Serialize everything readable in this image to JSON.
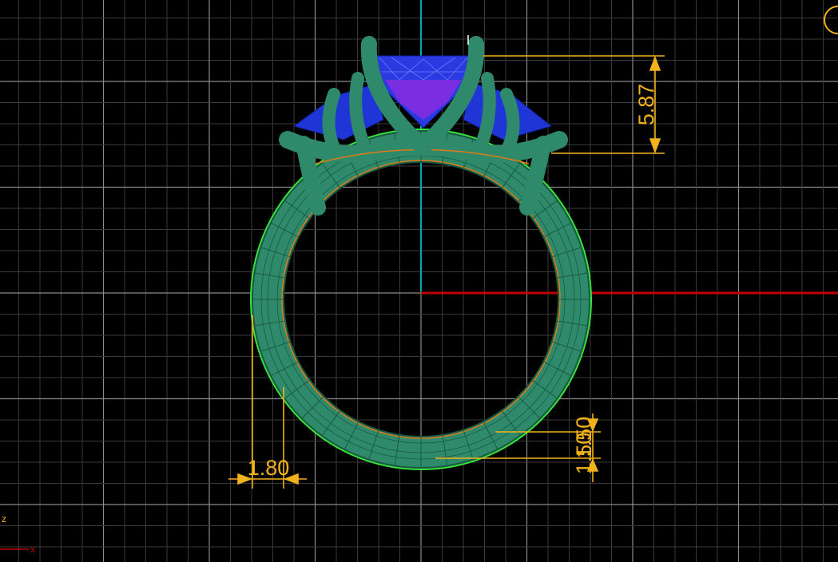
{
  "viewport": {
    "colors": {
      "background": "#000000",
      "grid_minor": "#3a3a3a",
      "grid_major": "#8a8a8a",
      "axis_x": "#c00000",
      "axis_y": "#00a8b0",
      "model": "#2e8a6a",
      "model_edge": "#1a5a44",
      "selection": "#39e639",
      "stone": "#2035d6",
      "center_stone": "#8a2be2",
      "dimension": "#f2b21a",
      "curve": "#e07a1a"
    },
    "axis_labels": {
      "z": "z",
      "x": "x"
    }
  },
  "dimensions": {
    "height": "5.87",
    "band_top": "1.50",
    "band_bottom": "1.50",
    "band_width": "1.80"
  },
  "icons": {
    "corner": "partial-circle-icon"
  }
}
